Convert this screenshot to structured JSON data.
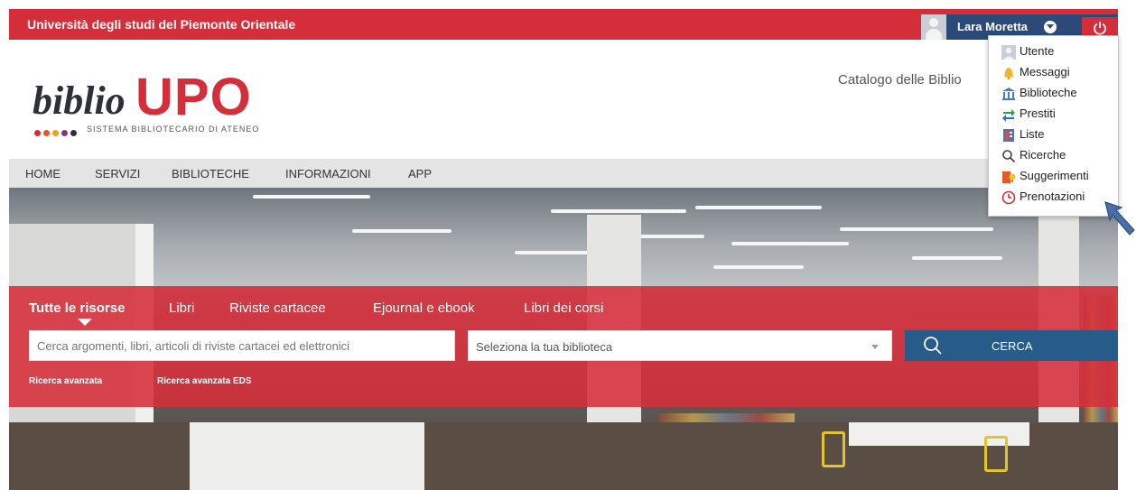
{
  "topbar": {
    "university": "Università degli studi del Piemonte Orientale",
    "user_name": "Lara Moretta"
  },
  "header": {
    "logo_biblio": "biblio",
    "logo_upo": "UPO",
    "logo_tagline": "SISTEMA BIBLIOTECARIO DI ATENEO",
    "catalogo_text": "Catalogo delle Biblio"
  },
  "nav": {
    "items": [
      "HOME",
      "SERVIZI",
      "BIBLIOTECHE",
      "INFORMAZIONI",
      "APP"
    ]
  },
  "search": {
    "tabs": [
      "Tutte le risorse",
      "Libri",
      "Riviste cartacee",
      "Ejournal e ebook",
      "Libri dei corsi"
    ],
    "active_tab": "Tutte le risorse",
    "input_placeholder": "Cerca argomenti, libri, articoli di riviste cartacei ed elettronici",
    "library_select": "Seleziona la tua biblioteca",
    "button_label": "CERCA",
    "advanced": "Ricerca avanzata",
    "advanced_eds": "Ricerca avanzata EDS"
  },
  "user_menu": {
    "items": [
      {
        "label": "Utente",
        "icon": "user-icon"
      },
      {
        "label": "Messaggi",
        "icon": "bell-icon"
      },
      {
        "label": "Biblioteche",
        "icon": "library-icon"
      },
      {
        "label": "Prestiti",
        "icon": "exchange-icon"
      },
      {
        "label": "Liste",
        "icon": "list-icon"
      },
      {
        "label": "Ricerche",
        "icon": "search-icon"
      },
      {
        "label": "Suggerimenti",
        "icon": "suggestion-icon"
      },
      {
        "label": "Prenotazioni",
        "icon": "clock-icon"
      }
    ]
  },
  "colors": {
    "brand_red": "#d42e3a",
    "user_bar_blue": "#2b4a78",
    "search_button_blue": "#275b8a",
    "annotation_arrow": "#4a6fa5"
  }
}
